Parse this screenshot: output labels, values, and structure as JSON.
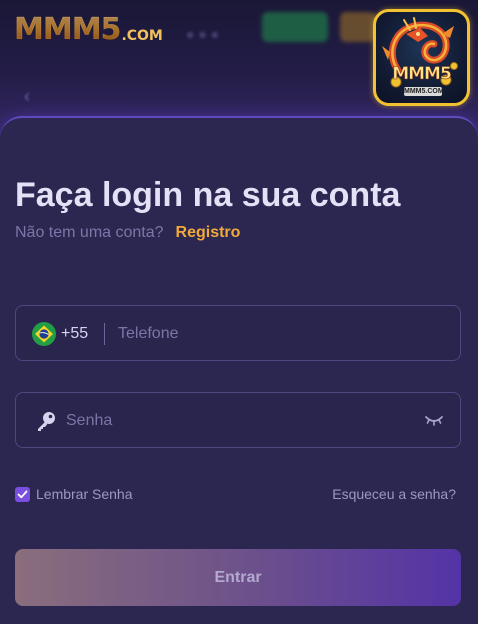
{
  "brand": {
    "logo_main": "MMM5",
    "logo_suffix": ".COM",
    "icon_brand": "MMM5",
    "icon_sub": "MMM5.COM"
  },
  "login": {
    "title": "Faça login na sua conta",
    "no_account_text": "Não tem uma conta?",
    "register_label": "Registro",
    "phone": {
      "country_flag": "brazil-flag-icon",
      "dial_code": "+55",
      "placeholder": "Telefone",
      "value": ""
    },
    "password": {
      "placeholder": "Senha",
      "value": ""
    },
    "remember_label": "Lembrar Senha",
    "remember_checked": true,
    "forgot_label": "Esqueceu a senha?",
    "submit_label": "Entrar"
  },
  "colors": {
    "background": "#1f1b3c",
    "card": "#2b2750",
    "accent": "#f2a93b",
    "checkbox": "#7a4fe0",
    "icon_border": "#f2c230"
  }
}
